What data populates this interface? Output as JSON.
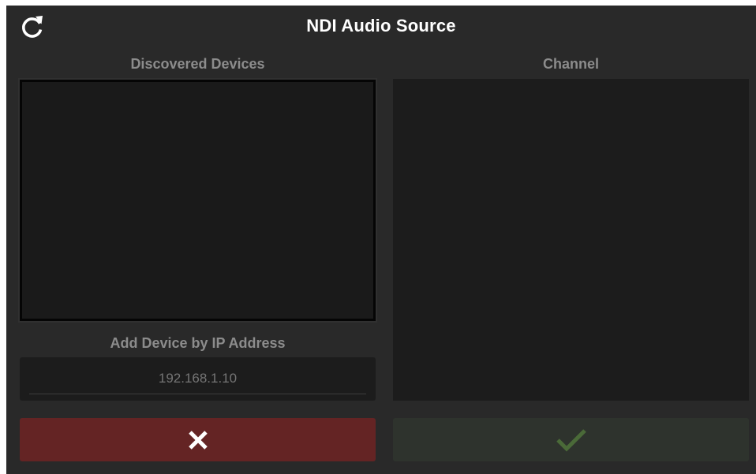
{
  "dialog": {
    "title": "NDI Audio Source",
    "refresh_icon": "refresh-icon"
  },
  "devices": {
    "label": "Discovered Devices",
    "items": []
  },
  "channel": {
    "label": "Channel",
    "items": []
  },
  "add_device": {
    "label": "Add Device by IP Address",
    "placeholder": "192.168.1.10",
    "value": ""
  },
  "actions": {
    "cancel_icon": "close-icon",
    "confirm_icon": "checkmark-icon"
  },
  "colors": {
    "background": "#292929",
    "panel": "#1c1c1c",
    "cancel": "#642424",
    "confirm": "#2e332d",
    "confirm_icon": "#4a6a38",
    "label": "#8c8c8c",
    "title": "#ffffff"
  }
}
